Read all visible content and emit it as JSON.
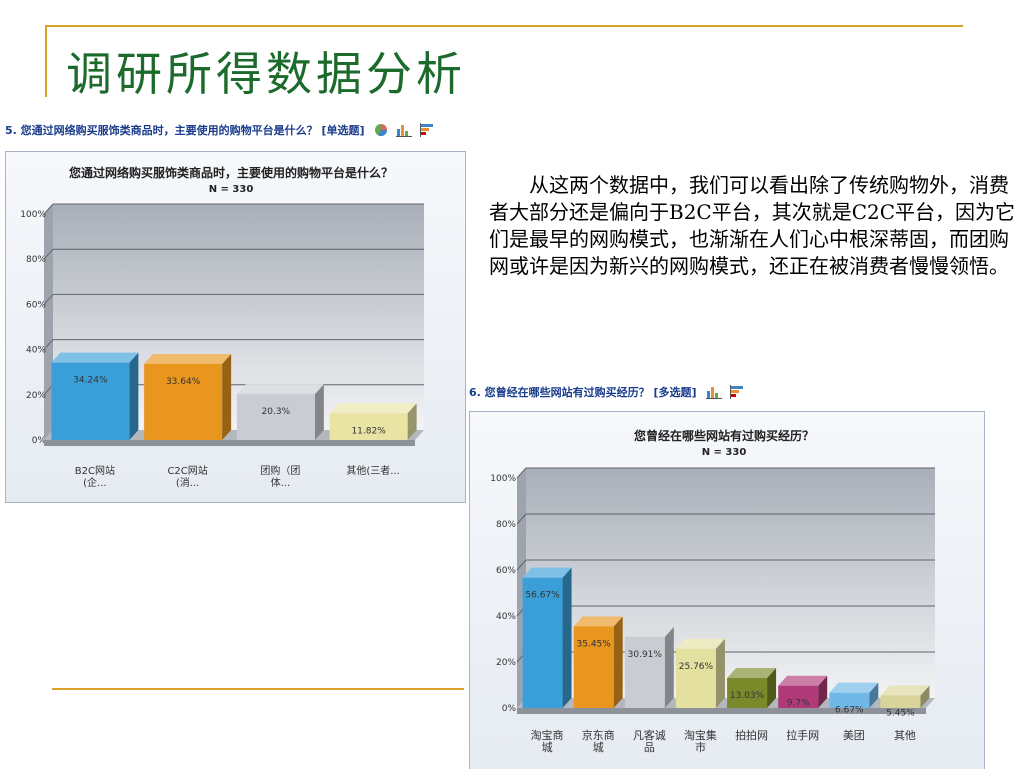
{
  "slide": {
    "title": "调研所得数据分析",
    "paragraph": "从这两个数据中，我们可以看出除了传统购物外，消费者大部分还是偏向于B2C平台，其次就是C2C平台，因为它们是最早的网购模式，也渐渐在人们心中根深蒂固，而团购网或许是因为新兴的网购模式，还正在被消费者慢慢领悟。"
  },
  "questions": [
    {
      "label": "5. 您通过网络购买服饰类商品时，主要使用的购物平台是什么？ [单选题]",
      "icons": [
        "pie-chart-icon",
        "bar-chart-icon",
        "horizontal-bar-icon"
      ]
    },
    {
      "label": "6. 您曾经在哪些网站有过购买经历？ [多选题]",
      "icons": [
        "bar-chart-icon",
        "horizontal-bar-icon"
      ]
    }
  ],
  "chart_data": [
    {
      "type": "bar",
      "title": "您通过网络购买服饰类商品时，主要使用的购物平台是什么？",
      "subtitle": "N = 330",
      "categories": [
        [
          "B2C网站",
          "(企..."
        ],
        [
          "C2C网站",
          "(消..."
        ],
        [
          "团购（团",
          "体..."
        ],
        [
          "其他(三者..."
        ]
      ],
      "values": [
        34.24,
        33.64,
        20.3,
        11.82
      ],
      "value_labels": [
        "34.24%",
        "33.64%",
        "20.3%",
        "11.82%"
      ],
      "colors": [
        "#3a9fd8",
        "#e8961e",
        "#c9ccd3",
        "#e9e4a4"
      ],
      "yticks": [
        "0%",
        "20%",
        "40%",
        "60%",
        "80%",
        "100%"
      ],
      "ylim": [
        0,
        100
      ],
      "grid": true
    },
    {
      "type": "bar",
      "title": "您曾经在哪些网站有过购买经历？",
      "subtitle": "N = 330",
      "categories": [
        [
          "淘宝商",
          "城"
        ],
        [
          "京东商",
          "城"
        ],
        [
          "凡客诚",
          "品"
        ],
        [
          "淘宝集",
          "市"
        ],
        [
          "拍拍网"
        ],
        [
          "拉手网"
        ],
        [
          "美团"
        ],
        [
          "其他"
        ]
      ],
      "values": [
        56.67,
        35.45,
        30.91,
        25.76,
        13.03,
        9.7,
        6.67,
        5.45
      ],
      "value_labels": [
        "56.67%",
        "35.45%",
        "30.91%",
        "25.76%",
        "13.03%",
        "9.7%",
        "6.67%",
        "5.45%"
      ],
      "colors": [
        "#3a9fd8",
        "#e8961e",
        "#c9ccd3",
        "#e4e0a0",
        "#7a8a2a",
        "#b03a78",
        "#6fb8e8",
        "#d8d49a"
      ],
      "yticks": [
        "0%",
        "20%",
        "40%",
        "60%",
        "80%",
        "100%"
      ],
      "ylim": [
        0,
        100
      ],
      "grid": true
    }
  ]
}
